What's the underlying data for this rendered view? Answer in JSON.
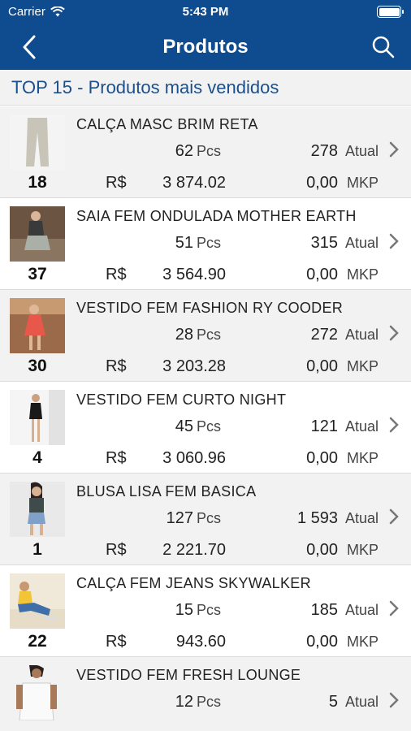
{
  "status_bar": {
    "carrier": "Carrier",
    "time": "5:43 PM"
  },
  "nav": {
    "title": "Produtos",
    "back_icon": "chevron-left-icon",
    "search_icon": "search-icon"
  },
  "section": {
    "title": "TOP 15 - Produtos mais vendidos"
  },
  "labels": {
    "qty_unit": "Pcs",
    "stock_unit": "Atual",
    "currency": "R$",
    "mkp_unit": "MKP"
  },
  "products": [
    {
      "rank": "18",
      "name": "CALÇA MASC BRIM RETA",
      "qty": "62",
      "stock": "278",
      "revenue": "3 874.02",
      "mkp": "0,00"
    },
    {
      "rank": "37",
      "name": "SAIA FEM ONDULADA MOTHER EARTH",
      "qty": "51",
      "stock": "315",
      "revenue": "3 564.90",
      "mkp": "0,00"
    },
    {
      "rank": "30",
      "name": "VESTIDO FEM FASHION RY COODER",
      "qty": "28",
      "stock": "272",
      "revenue": "3 203.28",
      "mkp": "0,00"
    },
    {
      "rank": "4",
      "name": "VESTIDO FEM CURTO NIGHT",
      "qty": "45",
      "stock": "121",
      "revenue": "3 060.96",
      "mkp": "0,00"
    },
    {
      "rank": "1",
      "name": "BLUSA LISA FEM BASICA",
      "qty": "127",
      "stock": "1 593",
      "revenue": "2 221.70",
      "mkp": "0,00"
    },
    {
      "rank": "22",
      "name": "CALÇA FEM JEANS SKYWALKER",
      "qty": "15",
      "stock": "185",
      "revenue": "943.60",
      "mkp": "0,00"
    },
    {
      "rank": "",
      "name": "VESTIDO FEM FRESH LOUNGE",
      "qty": "12",
      "stock": "5",
      "revenue": "",
      "mkp": ""
    }
  ]
}
